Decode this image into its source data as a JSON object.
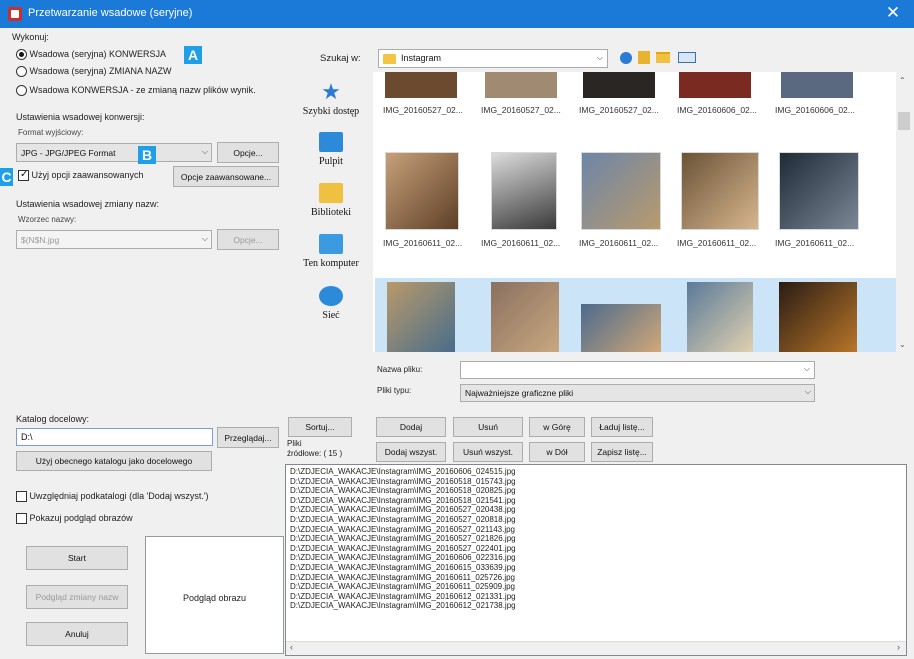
{
  "window": {
    "title": "Przetwarzanie wsadowe (seryjne)",
    "close": "✕"
  },
  "run": {
    "group_label": "Wykonuj:",
    "options": [
      "Wsadowa (seryjna) KONWERSJA",
      "Wsadowa (seryjna) ZMIANA NAZW",
      "Wsadowa  KONWERSJA - ze zmianą nazw plików wynik."
    ],
    "selected": 0
  },
  "badges": {
    "a": "A",
    "b": "B",
    "c": "C"
  },
  "conversion": {
    "group_label": "Ustawienia wsadowej konwersji:",
    "format_label": "Format wyjściowy:",
    "format_value": "JPG - JPG/JPEG Format",
    "options_button": "Opcje...",
    "advanced_checkbox": "Użyj opcji zaawansowanych",
    "advanced_button": "Opcje zaawansowane..."
  },
  "rename": {
    "group_label": "Ustawienia wsadowej zmiany nazw:",
    "pattern_label": "Wzorzec nazwy:",
    "pattern_value": "$(N$N.jpg",
    "options_button": "Opcje..."
  },
  "destination": {
    "label": "Katalog docelowy:",
    "value": "D:\\",
    "browse_button": "Przeglądaj...",
    "use_current_button": "Użyj obecnego katalogu jako docelowego"
  },
  "options": {
    "include_subfolders": "Uwzględniaj podkatalogi  (dla 'Dodaj wszyst.')",
    "show_preview": "Pokazuj podgląd obrazów"
  },
  "actions": {
    "start": "Start",
    "preview_rename": "Podgląd zmiany nazw",
    "cancel": "Anuluj",
    "preview_label": "Podgląd obrazu"
  },
  "browser": {
    "look_in_label": "Szukaj w:",
    "look_in_value": "Instagram",
    "places": [
      "Szybki dostęp",
      "Pulpit",
      "Biblioteki",
      "Ten komputer",
      "Sieć"
    ],
    "thumb_row1_labels": [
      "IMG_20160527_02...",
      "IMG_20160527_02...",
      "IMG_20160527_02...",
      "IMG_20160606_02...",
      "IMG_20160606_02..."
    ],
    "thumb_row2_labels": [
      "IMG_20160611_02...",
      "IMG_20160611_02...",
      "IMG_20160611_02...",
      "IMG_20160611_02...",
      "IMG_20160611_02..."
    ],
    "filename_label": "Nazwa pliku:",
    "filename_value": "",
    "filetype_label": "Pliki typu:",
    "filetype_value": "Najważniejsze graficzne pliki"
  },
  "list_buttons": {
    "sort": "Sortuj...",
    "add": "Dodaj",
    "remove": "Usuń",
    "up": "w Górę",
    "load": "Ładuj listę...",
    "add_all": "Dodaj wszyst.",
    "remove_all": "Usuń wszyst.",
    "down": "w Dół",
    "save": "Zapisz listę..."
  },
  "source": {
    "label_line1": "Pliki",
    "label_line2": "źródłowe: ( 15 )"
  },
  "files": [
    "D:\\ZDJECIA_WAKACJE\\Instagram\\IMG_20160606_024515.jpg",
    "D:\\ZDJECIA_WAKACJE\\Instagram\\IMG_20160518_015743.jpg",
    "D:\\ZDJECIA_WAKACJE\\Instagram\\IMG_20160518_020825.jpg",
    "D:\\ZDJECIA_WAKACJE\\Instagram\\IMG_20160518_021541.jpg",
    "D:\\ZDJECIA_WAKACJE\\Instagram\\IMG_20160527_020438.jpg",
    "D:\\ZDJECIA_WAKACJE\\Instagram\\IMG_20160527_020818.jpg",
    "D:\\ZDJECIA_WAKACJE\\Instagram\\IMG_20160527_021143.jpg",
    "D:\\ZDJECIA_WAKACJE\\Instagram\\IMG_20160527_021826.jpg",
    "D:\\ZDJECIA_WAKACJE\\Instagram\\IMG_20160527_022401.jpg",
    "D:\\ZDJECIA_WAKACJE\\Instagram\\IMG_20160606_022316.jpg",
    "D:\\ZDJECIA_WAKACJE\\Instagram\\IMG_20160615_033639.jpg",
    "D:\\ZDJECIA_WAKACJE\\Instagram\\IMG_20160611_025726.jpg",
    "D:\\ZDJECIA_WAKACJE\\Instagram\\IMG_20160611_025909.jpg",
    "D:\\ZDJECIA_WAKACJE\\Instagram\\IMG_20160612_021331.jpg",
    "D:\\ZDJECIA_WAKACJE\\Instagram\\IMG_20160612_021738.jpg"
  ],
  "colors": {
    "titlebar": "#1b7ad8",
    "badge": "#1e9fe8"
  }
}
